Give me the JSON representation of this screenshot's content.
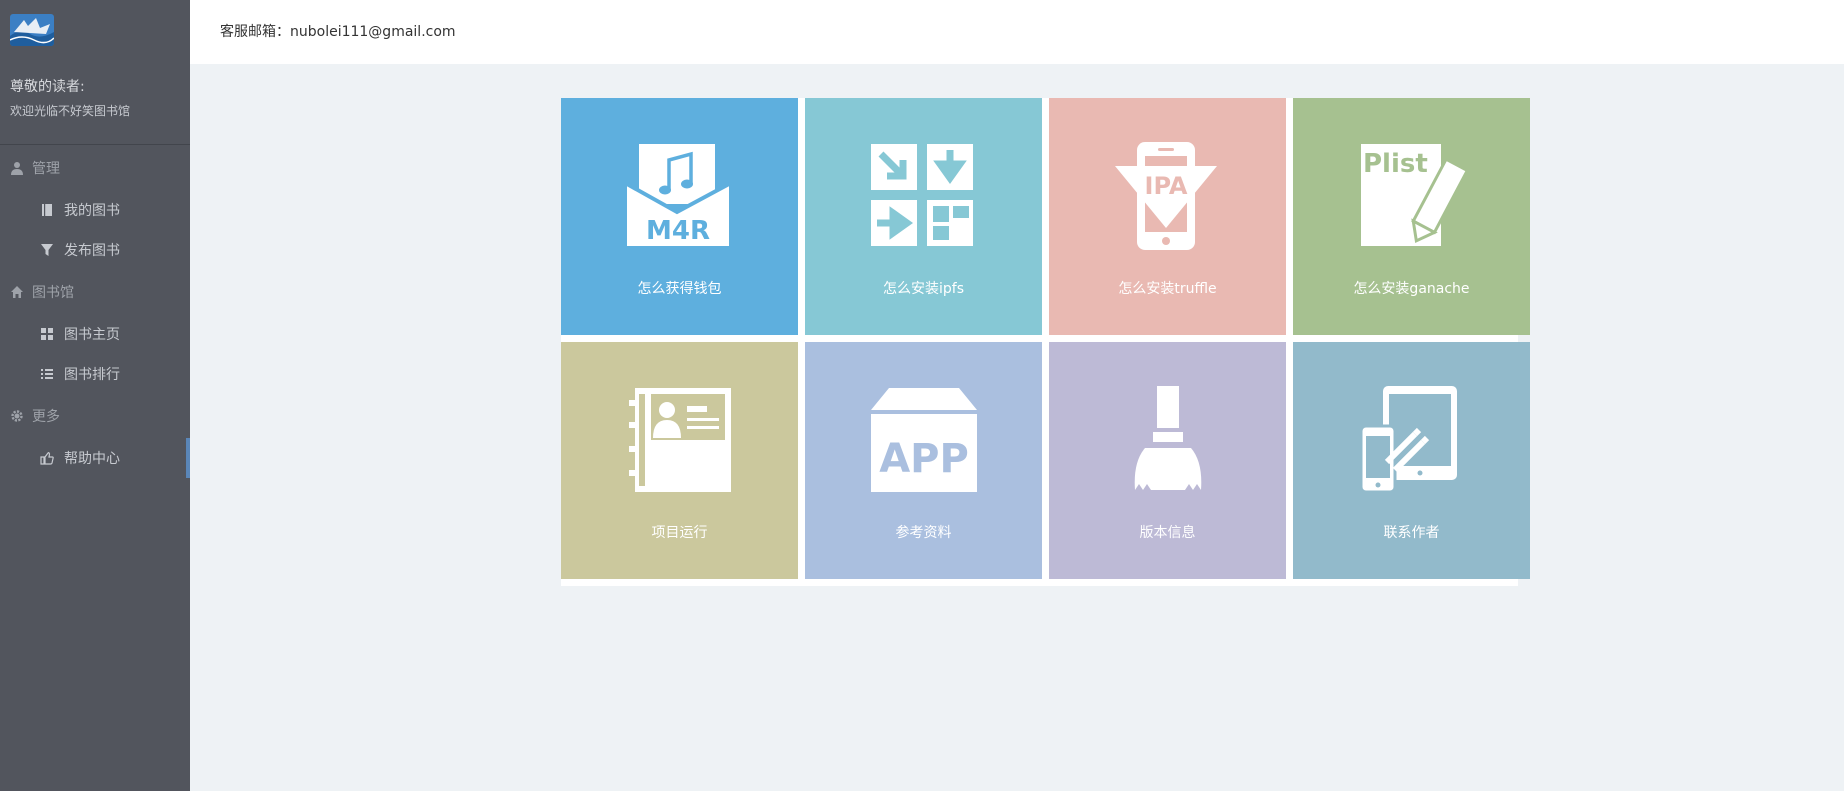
{
  "sidebar": {
    "greeting_title": "尊敬的读者:",
    "greeting_sub": "欢迎光临不好笑图书馆",
    "sections": [
      {
        "label": "管理",
        "icon": "user-icon"
      },
      {
        "label": "图书馆",
        "icon": "home-icon"
      },
      {
        "label": "更多",
        "icon": "gear-icon"
      }
    ],
    "items": [
      {
        "label": "我的图书",
        "icon": "book-icon"
      },
      {
        "label": "发布图书",
        "icon": "filter-icon"
      },
      {
        "label": "图书主页",
        "icon": "grid-icon"
      },
      {
        "label": "图书排行",
        "icon": "list-icon"
      },
      {
        "label": "帮助中心",
        "icon": "hand-pointer-icon"
      }
    ]
  },
  "header": {
    "email_label": "客服邮箱：nubolei111@gmail.com"
  },
  "tiles": [
    {
      "label": "怎么获得钱包",
      "color": "#5eafde",
      "icon": "m4r-icon",
      "icon_text": "M4R"
    },
    {
      "label": "怎么安装ipfs",
      "color": "#86c8d5",
      "icon": "arrows-grid-icon"
    },
    {
      "label": "怎么安装truffle",
      "color": "#e9b9b2",
      "icon": "ipa-phone-icon",
      "icon_text": "IPA"
    },
    {
      "label": "怎么安装ganache",
      "color": "#a6c190",
      "icon": "plist-pencil-icon",
      "icon_text": "Plist"
    },
    {
      "label": "项目运行",
      "color": "#cbc89d",
      "icon": "contact-book-icon"
    },
    {
      "label": "参考资料",
      "color": "#aabfdf",
      "icon": "app-box-icon",
      "icon_text": "APP"
    },
    {
      "label": "版本信息",
      "color": "#bdbad6",
      "icon": "brush-icon"
    },
    {
      "label": "联系作者",
      "color": "#92bacb",
      "icon": "devices-icon"
    }
  ]
}
